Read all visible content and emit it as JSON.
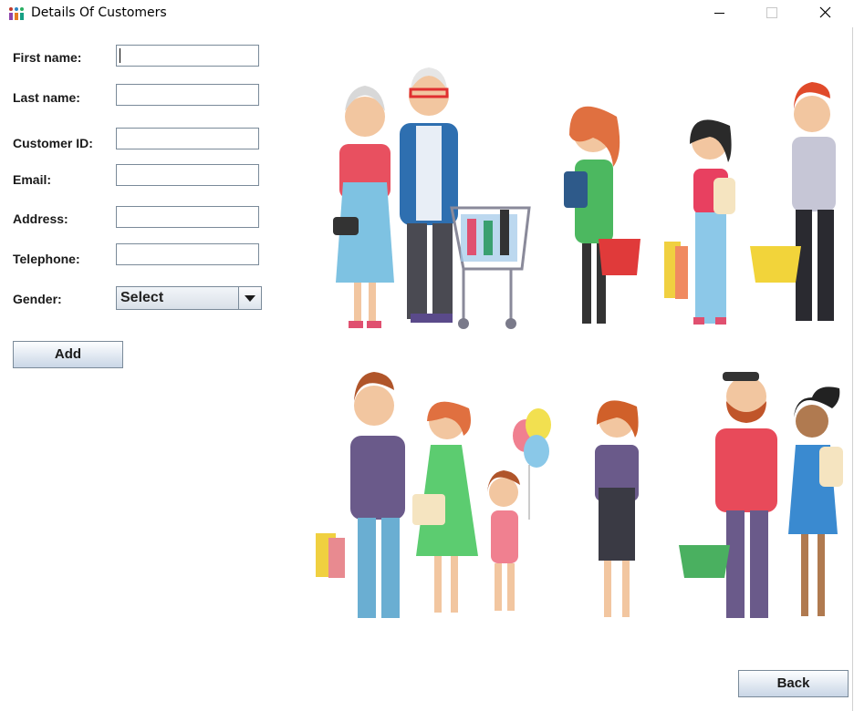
{
  "window": {
    "title": "Details Of Customers"
  },
  "form": {
    "first_name_label": "First name:",
    "last_name_label": "Last name:",
    "customer_id_label": "Customer ID:",
    "email_label": "Email:",
    "address_label": "Address:",
    "telephone_label": "Telephone:",
    "gender_label": "Gender:",
    "first_name_value": "",
    "last_name_value": "",
    "customer_id_value": "",
    "email_value": "",
    "address_value": "",
    "telephone_value": "",
    "gender_selected": "Select"
  },
  "buttons": {
    "add_label": "Add",
    "back_label": "Back"
  },
  "icons": {
    "app": "app-icon",
    "minimize": "minimize-icon",
    "maximize": "maximize-icon",
    "close": "close-icon",
    "dropdown": "chevron-down-icon"
  },
  "colors": {
    "field_border": "#7a8a99",
    "button_gradient_top": "#fdfeff",
    "button_gradient_bottom": "#c9d6e6"
  }
}
